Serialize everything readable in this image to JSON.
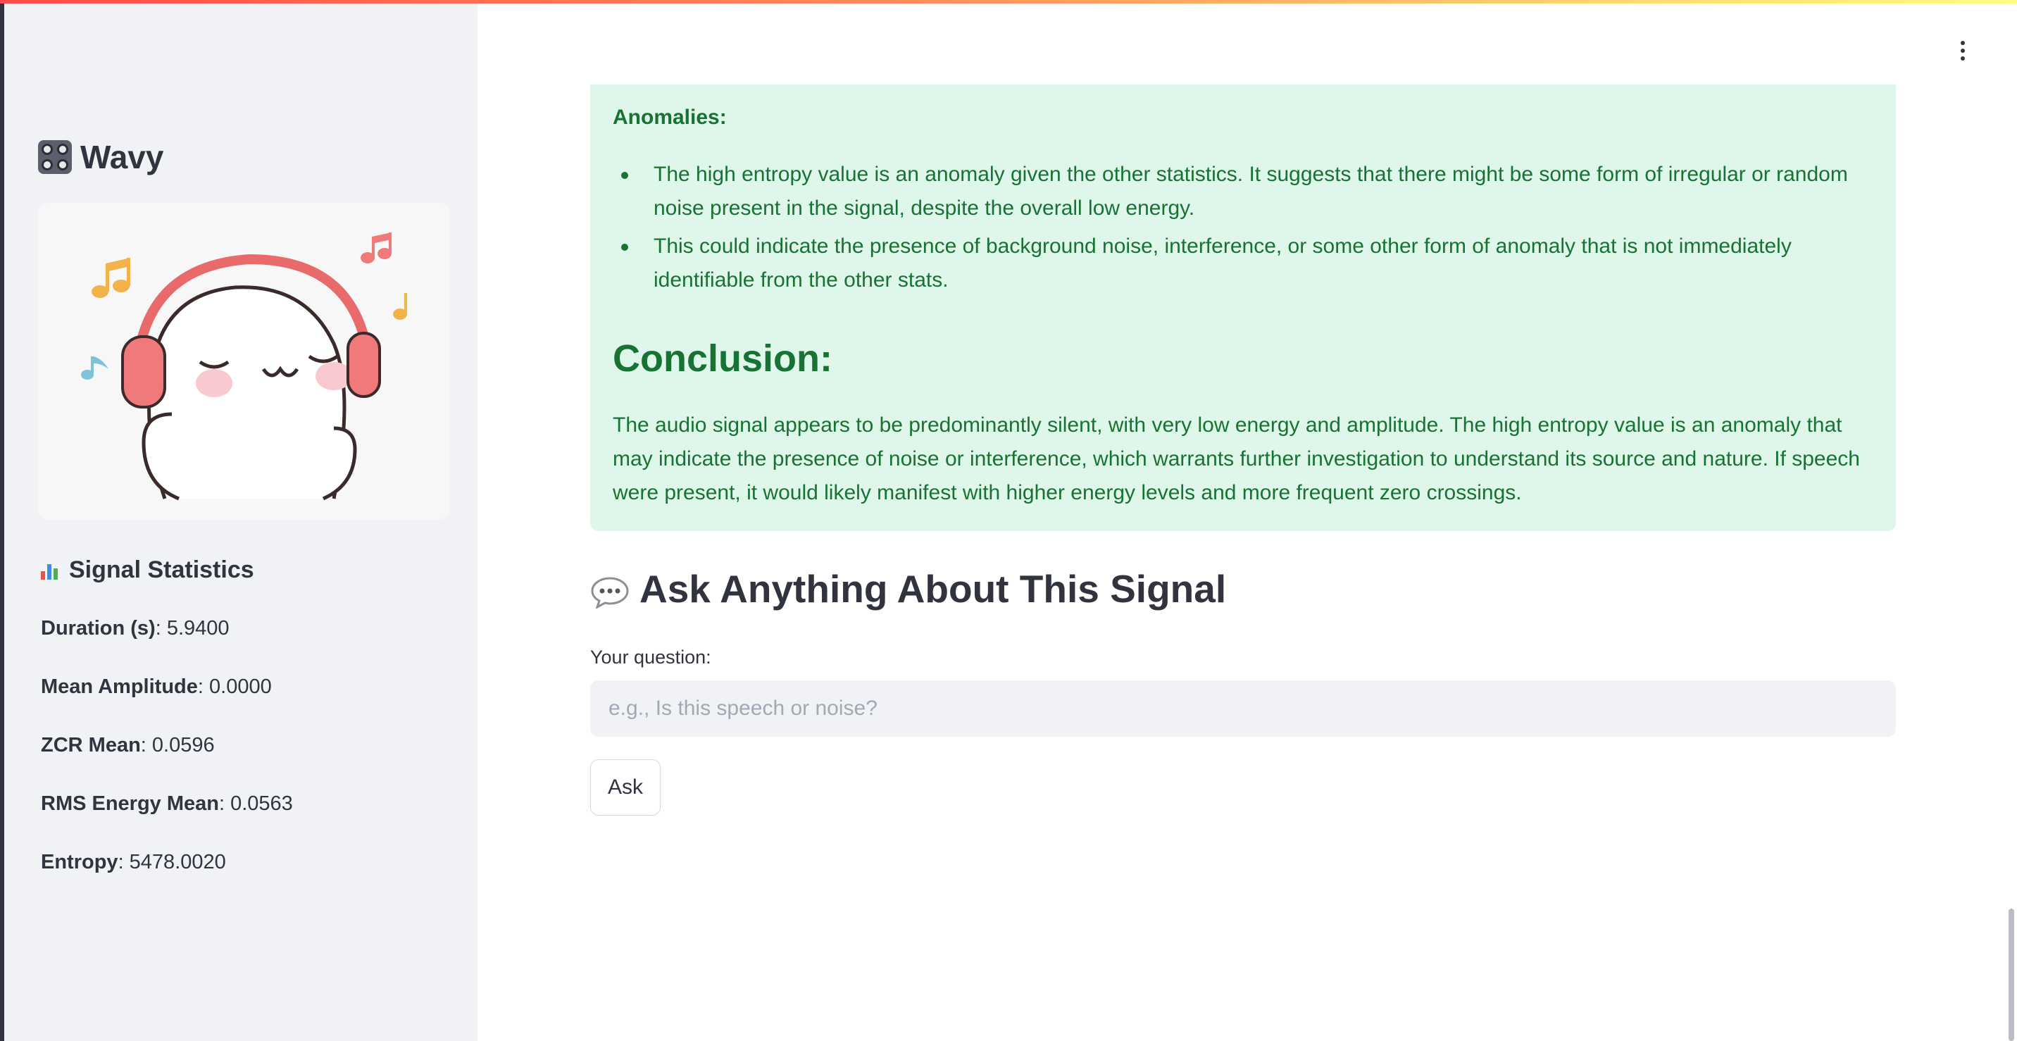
{
  "sidebar": {
    "title": "Wavy",
    "title_icon": "dice-icon",
    "image_icon": "headphones-music-illustration",
    "stats_title": "Signal Statistics",
    "stats_icon": "bar-chart-icon",
    "stats": [
      {
        "label": "Duration (s)",
        "value": ": 5.9400"
      },
      {
        "label": "Mean Amplitude",
        "value": ": 0.0000"
      },
      {
        "label": "ZCR Mean",
        "value": ": 0.0596"
      },
      {
        "label": "RMS Energy Mean",
        "value": ": 0.0563"
      },
      {
        "label": "Entropy",
        "value": ": 5478.0020"
      }
    ]
  },
  "main": {
    "menu_icon": "more-vertical-icon",
    "analysis": {
      "anomalies_label": "Anomalies:",
      "bullets": [
        "The high entropy value is an anomaly given the other statistics. It suggests that there might be some form of irregular or random noise present in the signal, despite the overall low energy.",
        "This could indicate the presence of background noise, interference, or some other form of anomaly that is not immediately identifiable from the other stats."
      ],
      "conclusion_heading": "Conclusion:",
      "conclusion_text": "The audio signal appears to be predominantly silent, with very low energy and amplitude. The high entropy value is an anomaly that may indicate the presence of noise or interference, which warrants further investigation to understand its source and nature. If speech were present, it would likely manifest with higher energy levels and more frequent zero crossings."
    },
    "ask": {
      "title": "Ask Anything About This Signal",
      "title_icon": "speech-bubble-icon",
      "question_label": "Your question:",
      "placeholder": "e.g., Is this speech or noise?",
      "value": "",
      "button_label": "Ask"
    }
  },
  "colors": {
    "sidebar_bg": "#f0f2f6",
    "success_bg": "#dff6ea",
    "success_text": "#177233",
    "text": "#31333f"
  }
}
